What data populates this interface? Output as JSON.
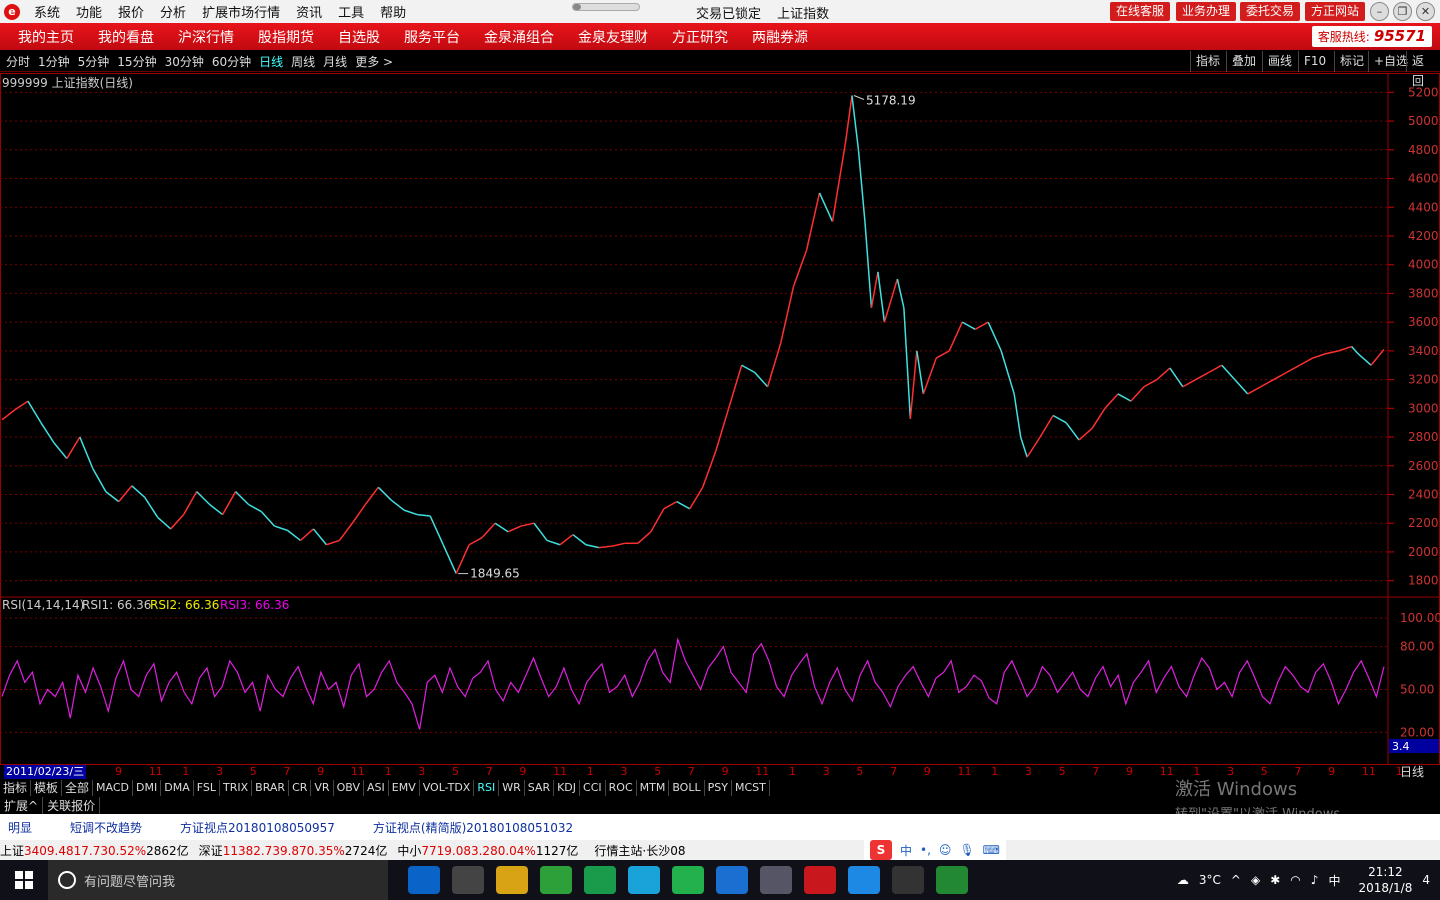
{
  "titlebar": {
    "menu": [
      "系统",
      "功能",
      "报价",
      "分析",
      "扩展市场行情",
      "资讯",
      "工具",
      "帮助"
    ],
    "status": "交易已锁定",
    "security": "上证指数",
    "buttons": [
      "在线客服",
      "业务办理",
      "委托交易",
      "方正网站"
    ]
  },
  "navbar": {
    "items": [
      "我的主页",
      "我的看盘",
      "沪深行情",
      "股指期货",
      "自选股",
      "服务平台",
      "金泉涌组合",
      "金泉友理财",
      "方正研究",
      "两融券源"
    ],
    "hotline_label": "客服热线:",
    "hotline": "95571"
  },
  "periods": [
    "分时",
    "1分钟",
    "5分钟",
    "15分钟",
    "30分钟",
    "60分钟",
    "日线",
    "周线",
    "月线",
    "更多 >"
  ],
  "active_period": "日线",
  "right_tools": [
    "指标",
    "叠加",
    "画线",
    "F10",
    "标记",
    "+自选",
    "返回"
  ],
  "chart_title": "999999 上证指数(日线)",
  "chart_data": {
    "type": "line",
    "price": {
      "ylim": [
        1700,
        5300
      ],
      "ticks": [
        1800,
        2000,
        2200,
        2400,
        2600,
        2800,
        3000,
        3200,
        3400,
        3600,
        3800,
        4000,
        4200,
        4400,
        4600,
        4800,
        5000,
        5200
      ],
      "high_label": "5178.19",
      "low_label": "1849.65",
      "points": [
        [
          0,
          2920
        ],
        [
          2,
          2990
        ],
        [
          4,
          3050
        ],
        [
          6,
          2900
        ],
        [
          8,
          2760
        ],
        [
          10,
          2650
        ],
        [
          12,
          2800
        ],
        [
          14,
          2580
        ],
        [
          16,
          2420
        ],
        [
          18,
          2350
        ],
        [
          20,
          2460
        ],
        [
          22,
          2380
        ],
        [
          24,
          2240
        ],
        [
          26,
          2160
        ],
        [
          28,
          2260
        ],
        [
          30,
          2420
        ],
        [
          32,
          2330
        ],
        [
          34,
          2260
        ],
        [
          36,
          2420
        ],
        [
          38,
          2330
        ],
        [
          40,
          2280
        ],
        [
          42,
          2180
        ],
        [
          44,
          2150
        ],
        [
          46,
          2080
        ],
        [
          48,
          2160
        ],
        [
          50,
          2050
        ],
        [
          52,
          2080
        ],
        [
          54,
          2200
        ],
        [
          56,
          2330
        ],
        [
          58,
          2450
        ],
        [
          60,
          2360
        ],
        [
          62,
          2290
        ],
        [
          64,
          2260
        ],
        [
          66,
          2250
        ],
        [
          68,
          2050
        ],
        [
          70,
          1849
        ],
        [
          72,
          2050
        ],
        [
          74,
          2100
        ],
        [
          76,
          2200
        ],
        [
          78,
          2140
        ],
        [
          80,
          2180
        ],
        [
          82,
          2200
        ],
        [
          84,
          2080
        ],
        [
          86,
          2050
        ],
        [
          88,
          2120
        ],
        [
          90,
          2050
        ],
        [
          92,
          2030
        ],
        [
          94,
          2040
        ],
        [
          96,
          2060
        ],
        [
          98,
          2060
        ],
        [
          100,
          2140
        ],
        [
          102,
          2300
        ],
        [
          104,
          2350
        ],
        [
          106,
          2300
        ],
        [
          108,
          2450
        ],
        [
          110,
          2700
        ],
        [
          112,
          3000
        ],
        [
          114,
          3300
        ],
        [
          116,
          3250
        ],
        [
          118,
          3150
        ],
        [
          120,
          3450
        ],
        [
          122,
          3850
        ],
        [
          124,
          4100
        ],
        [
          126,
          4500
        ],
        [
          128,
          4300
        ],
        [
          130,
          4850
        ],
        [
          131,
          5178
        ],
        [
          132,
          4800
        ],
        [
          133,
          4300
        ],
        [
          134,
          3700
        ],
        [
          135,
          3950
        ],
        [
          136,
          3600
        ],
        [
          138,
          3900
        ],
        [
          139,
          3700
        ],
        [
          140,
          2927
        ],
        [
          141,
          3400
        ],
        [
          142,
          3100
        ],
        [
          144,
          3350
        ],
        [
          146,
          3400
        ],
        [
          148,
          3600
        ],
        [
          150,
          3550
        ],
        [
          152,
          3600
        ],
        [
          154,
          3400
        ],
        [
          156,
          3100
        ],
        [
          157,
          2800
        ],
        [
          158,
          2660
        ],
        [
          160,
          2800
        ],
        [
          162,
          2950
        ],
        [
          164,
          2900
        ],
        [
          166,
          2780
        ],
        [
          168,
          2860
        ],
        [
          170,
          3000
        ],
        [
          172,
          3100
        ],
        [
          174,
          3050
        ],
        [
          176,
          3150
        ],
        [
          178,
          3200
        ],
        [
          180,
          3280
        ],
        [
          182,
          3150
        ],
        [
          184,
          3200
        ],
        [
          186,
          3250
        ],
        [
          188,
          3300
        ],
        [
          190,
          3200
        ],
        [
          192,
          3100
        ],
        [
          194,
          3150
        ],
        [
          196,
          3200
        ],
        [
          198,
          3250
        ],
        [
          200,
          3300
        ],
        [
          202,
          3350
        ],
        [
          204,
          3380
        ],
        [
          206,
          3400
        ],
        [
          208,
          3430
        ],
        [
          209,
          3380
        ],
        [
          211,
          3300
        ],
        [
          213,
          3410
        ]
      ]
    },
    "rsi": {
      "label": "RSI(14,14,14)",
      "rsi1_label": "RSI1: 66.36",
      "rsi2_label": "RSI2: 66.36",
      "rsi3_label": "RSI3: 66.36",
      "ylim": [
        0,
        100
      ],
      "ticks": [
        20,
        50,
        80,
        100
      ],
      "tick_labels": [
        "20.00",
        "50.00",
        "80.00",
        "100.00"
      ],
      "last_value_label": "3.4",
      "values": [
        45,
        60,
        70,
        55,
        62,
        40,
        50,
        45,
        55,
        30,
        60,
        48,
        65,
        52,
        35,
        58,
        70,
        50,
        45,
        60,
        68,
        42,
        55,
        62,
        48,
        40,
        58,
        65,
        45,
        52,
        70,
        62,
        48,
        55,
        35,
        60,
        50,
        45,
        58,
        66,
        52,
        40,
        62,
        50,
        55,
        38,
        60,
        68,
        45,
        50,
        62,
        70,
        55,
        48,
        40,
        22,
        55,
        60,
        48,
        65,
        52,
        45,
        58,
        62,
        70,
        50,
        42,
        55,
        48,
        60,
        72,
        58,
        45,
        52,
        65,
        50,
        40,
        55,
        62,
        68,
        48,
        52,
        60,
        45,
        55,
        70,
        78,
        62,
        55,
        85,
        70,
        60,
        50,
        65,
        72,
        80,
        62,
        55,
        48,
        75,
        82,
        70,
        52,
        45,
        60,
        68,
        75,
        52,
        40,
        55,
        65,
        50,
        42,
        60,
        70,
        55,
        48,
        38,
        52,
        60,
        66,
        55,
        45,
        58,
        62,
        70,
        48,
        52,
        60,
        56,
        44,
        40,
        62,
        70,
        58,
        45,
        52,
        66,
        60,
        48,
        55,
        62,
        50,
        45,
        58,
        66,
        52,
        60,
        40,
        55,
        62,
        70,
        48,
        58,
        66,
        52,
        45,
        60,
        72,
        65,
        50,
        55,
        45,
        62,
        70,
        58,
        45,
        40,
        55,
        66,
        60,
        52,
        48,
        62,
        68,
        56,
        40,
        50,
        62,
        70,
        58,
        45,
        66
      ]
    },
    "x_months": [
      "9",
      "11",
      "1",
      "3",
      "5",
      "7",
      "9",
      "11",
      "1",
      "3",
      "5",
      "7",
      "9",
      "11",
      "1",
      "3",
      "5",
      "7",
      "9",
      "11",
      "1",
      "3",
      "5",
      "7",
      "9",
      "11",
      "1",
      "3",
      "5",
      "7",
      "9",
      "11",
      "1",
      "3",
      "5",
      "7",
      "9",
      "11",
      "1"
    ],
    "start_date": "2011/02/23/三",
    "period_label": "日线"
  },
  "indicator_tabs": [
    "指标",
    "模板",
    "全部",
    "MACD",
    "DMI",
    "DMA",
    "FSL",
    "TRIX",
    "BRAR",
    "CR",
    "VR",
    "OBV",
    "ASI",
    "EMV",
    "VOL-TDX",
    "RSI",
    "WR",
    "SAR",
    "KDJ",
    "CCI",
    "ROC",
    "MTM",
    "BOLL",
    "PSY",
    "MCST"
  ],
  "active_indicator": "RSI",
  "ext_tabs": [
    "扩展^",
    "关联报价"
  ],
  "watermark": {
    "title": "激活 Windows",
    "sub": "转到\"设置\"以激活 Windows。"
  },
  "news": [
    "明显",
    "短调不改趋势",
    "方证视点20180108050957",
    "方证视点(精简版)20180108051032"
  ],
  "quotes": [
    {
      "name": "上证",
      "value": "3409.48",
      "chg": "17.73",
      "pct": "0.52%",
      "amt": "2862亿"
    },
    {
      "name": "深证",
      "value": "11382.7",
      "chg": "39.87",
      "pct": "0.35%",
      "amt": "2724亿"
    },
    {
      "name": "中小",
      "value": "7719.08",
      "chg": "3.28",
      "pct": "0.04%",
      "amt": "1127亿"
    }
  ],
  "station": "行情主站·长沙08",
  "taskbar": {
    "search_placeholder": "有问题尽管问我",
    "weather": "3°C",
    "ime": "中",
    "time": "21:12",
    "date": "2018/1/8",
    "notifications": "4"
  }
}
